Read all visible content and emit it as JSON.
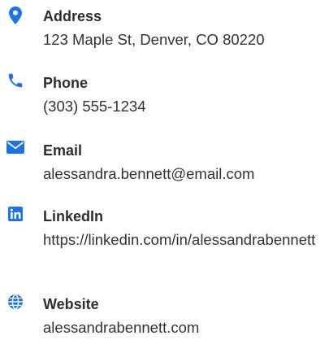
{
  "accent_color": "#1a73e8",
  "contact": {
    "address": {
      "icon": "map-marker-icon",
      "label": "Address",
      "value": "123 Maple St, Denver, CO 80220"
    },
    "phone": {
      "icon": "phone-icon",
      "label": "Phone",
      "value": "(303) 555-1234"
    },
    "email": {
      "icon": "envelope-icon",
      "label": "Email",
      "value": "alessandra.bennett@email.com"
    },
    "linkedin": {
      "icon": "linkedin-icon",
      "label": "LinkedIn",
      "value": "https://linkedin.com/in/alessandrabennett"
    },
    "website": {
      "icon": "globe-icon",
      "label": "Website",
      "value": "alessandrabennett.com"
    }
  }
}
